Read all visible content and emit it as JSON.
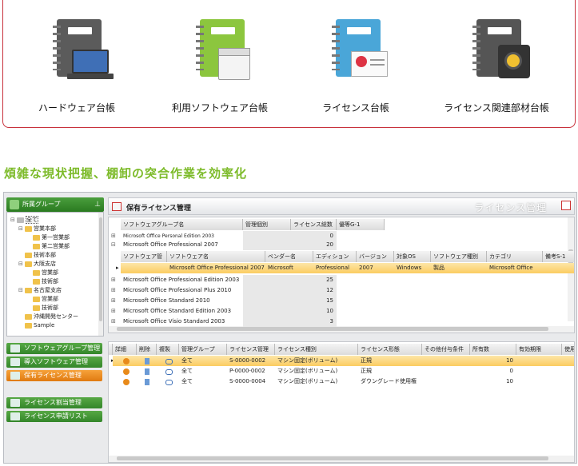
{
  "features": [
    {
      "label": "ハードウェア台帳",
      "icon": "laptop-ledger-icon"
    },
    {
      "label": "利用ソフトウェア台帳",
      "icon": "software-box-ledger-icon"
    },
    {
      "label": "ライセンス台帳",
      "icon": "license-certificate-ledger-icon"
    },
    {
      "label": "ライセンス関連部材台帳",
      "icon": "safe-ledger-icon"
    }
  ],
  "headline": "煩雑な現状把握、棚卸の突合作業を効率化",
  "sidebar": {
    "title": "所属グループ",
    "tree": [
      {
        "label": "全て",
        "pm": "⊟",
        "indent": 0
      },
      {
        "label": "営業本部",
        "pm": "⊟",
        "indent": 1
      },
      {
        "label": "第一営業部",
        "pm": "",
        "indent": 2
      },
      {
        "label": "第二営業部",
        "pm": "",
        "indent": 2
      },
      {
        "label": "技術本部",
        "pm": "",
        "indent": 1
      },
      {
        "label": "大阪支店",
        "pm": "⊟",
        "indent": 1
      },
      {
        "label": "営業部",
        "pm": "",
        "indent": 2
      },
      {
        "label": "技術部",
        "pm": "",
        "indent": 2
      },
      {
        "label": "名古屋支店",
        "pm": "⊟",
        "indent": 1
      },
      {
        "label": "営業部",
        "pm": "",
        "indent": 2
      },
      {
        "label": "技術部",
        "pm": "",
        "indent": 2
      },
      {
        "label": "沖縄開発センター",
        "pm": "",
        "indent": 1
      },
      {
        "label": "Sample",
        "pm": "",
        "indent": 1
      }
    ],
    "nav": [
      {
        "label": "ソフトウェアグループ管理",
        "active": false
      },
      {
        "label": "導入ソフトウェア管理",
        "active": false
      },
      {
        "label": "保有ライセンス管理",
        "active": true
      },
      {
        "label": "ライセンス割当管理",
        "active": false
      },
      {
        "label": "ライセンス申請リスト",
        "active": false
      }
    ]
  },
  "panel": {
    "title": "保有ライセンス管理",
    "watermark": "ライセンス管理"
  },
  "grid1": {
    "headers": [
      "ソフトウェアグループ名",
      "管理個別",
      "ライセンス総数",
      "優等G-1"
    ],
    "partial_row": {
      "name": "Microsoft Office Personal Edition 2003",
      "count": "0"
    },
    "expanded": {
      "name": "Microsoft Office Professional 2007",
      "count": "20"
    },
    "sub_headers": [
      "ソフトウェア管",
      "ソフトウェア名",
      "ベンダー名",
      "エディション",
      "バージョン",
      "対象OS",
      "ソフトウェア種別",
      "カテゴリ",
      "備考S-1"
    ],
    "sub_row": [
      "",
      "Microsoft Office Professional 2007",
      "Microsoft",
      "Professional",
      "2007",
      "Windows",
      "製品",
      "Microsoft Office",
      ""
    ],
    "rows": [
      {
        "name": "Microsoft Office Professional Edition 2003",
        "count": "25"
      },
      {
        "name": "Microsoft Office Professional Plus 2010",
        "count": "12"
      },
      {
        "name": "Microsoft Office Standard 2010",
        "count": "15"
      },
      {
        "name": "Microsoft Office Standard Edition 2003",
        "count": "10"
      },
      {
        "name": "Microsoft Office Visio Standard 2003",
        "count": "3"
      }
    ]
  },
  "grid2": {
    "headers": [
      "詳細",
      "削除",
      "複製",
      "管理グループ",
      "ライセンス管理",
      "ライセンス種別",
      "ライセンス形態",
      "その他付与条件",
      "所有数",
      "有効期限",
      "使用日"
    ],
    "rows": [
      {
        "group": "全て",
        "id": "S-0000-0002",
        "kind": "マシン固定(ボリューム)",
        "form": "正規",
        "qty": "10"
      },
      {
        "group": "全て",
        "id": "P-0000-0002",
        "kind": "マシン固定(ボリューム)",
        "form": "正規",
        "qty": "0"
      },
      {
        "group": "全て",
        "id": "S-0000-0004",
        "kind": "マシン固定(ボリューム)",
        "form": "ダウングレード使用権",
        "qty": "10"
      }
    ]
  }
}
